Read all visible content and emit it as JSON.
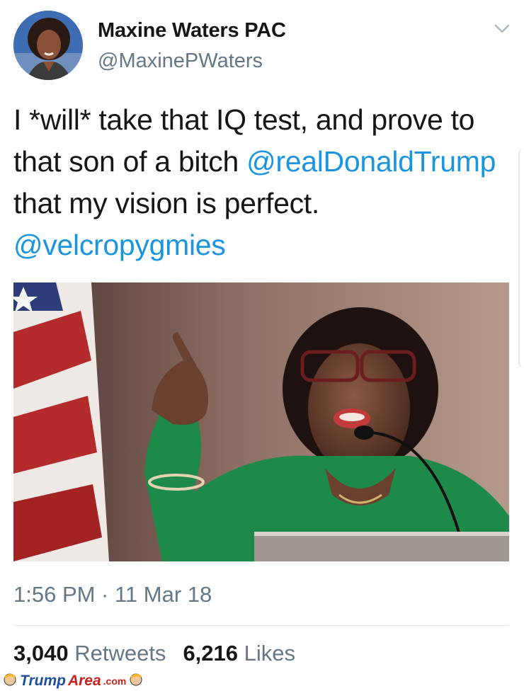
{
  "tweet": {
    "display_name": "Maxine Waters PAC",
    "handle": "@MaxinePWaters",
    "text_parts": {
      "p1": "I *will* take that IQ test, and prove to that son of a bitch ",
      "mention1": "@realDonaldTrump",
      "p2": " that my vision is perfect. ",
      "mention2": "@velcropygmies"
    },
    "timestamp": "1:56 PM · 11 Mar 18",
    "retweets_count": "3,040",
    "retweets_label": "Retweets",
    "likes_count": "6,216",
    "likes_label": "Likes"
  },
  "watermark": {
    "trump": "Trump",
    "area": "Area",
    "com": ".com"
  },
  "colors": {
    "link": "#1b95e0",
    "secondary_text": "#657786",
    "primary_text": "#14171a"
  },
  "icons": [
    "chevron-down-icon",
    "avatar",
    "cartoon-trump-icon"
  ]
}
